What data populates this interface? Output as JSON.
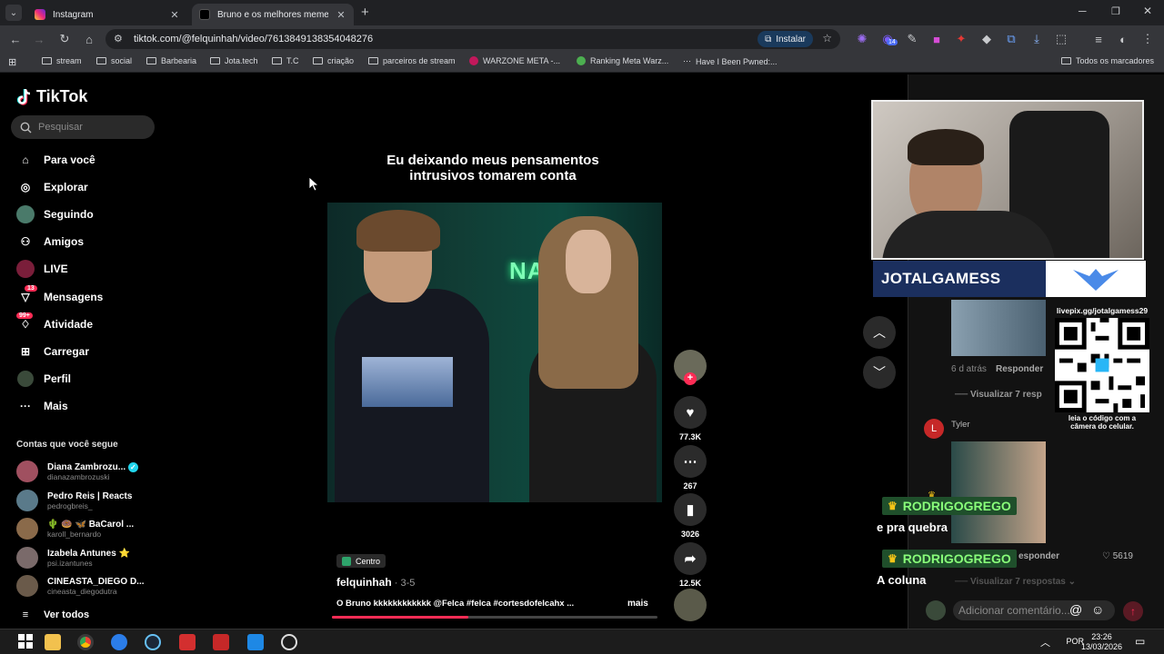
{
  "browser": {
    "tabs": [
      {
        "title": "Instagram",
        "active": false
      },
      {
        "title": "Bruno e os melhores memes de",
        "active": true
      }
    ],
    "url": "tiktok.com/@felquinhah/video/7613849138354048276",
    "install_label": "Instalar",
    "bookmarks": [
      "stream",
      "social",
      "Barbearia",
      "Jota.tech",
      "T.C",
      "criação",
      "parceiros de stream",
      "WARZONE META -...",
      "Ranking Meta Warz...",
      "Have I Been Pwned:..."
    ],
    "all_bookmarks": "Todos os marcadores",
    "ext_badge": "14"
  },
  "tiktok": {
    "logo": "TikTok",
    "search_placeholder": "Pesquisar",
    "nav": [
      {
        "label": "Para você",
        "icon": "home-icon"
      },
      {
        "label": "Explorar",
        "icon": "compass-icon"
      },
      {
        "label": "Seguindo",
        "icon": "following-avatar-icon"
      },
      {
        "label": "Amigos",
        "icon": "friends-icon"
      },
      {
        "label": "LIVE",
        "icon": "live-icon"
      },
      {
        "label": "Mensagens",
        "icon": "messages-icon",
        "badge": "13"
      },
      {
        "label": "Atividade",
        "icon": "activity-icon",
        "badge": "99+"
      },
      {
        "label": "Carregar",
        "icon": "upload-icon"
      },
      {
        "label": "Perfil",
        "icon": "profile-avatar-icon"
      },
      {
        "label": "Mais",
        "icon": "more-icon"
      }
    ],
    "following_title": "Contas que você segue",
    "accounts": [
      {
        "name": "Diana Zambrozu...",
        "handle": "dianazambrozuski",
        "verified": true,
        "color": "#a05060"
      },
      {
        "name": "Pedro Reis | Reacts",
        "handle": "pedrogbreis_",
        "verified": false,
        "color": "#5a7a8a"
      },
      {
        "name": "🌵 🍩 🦋 BaCarol ...",
        "handle": "karoll_bernardo",
        "verified": false,
        "color": "#8a6a4a"
      },
      {
        "name": "Izabela Antunes ⭐",
        "handle": "psi.izantunes",
        "verified": false,
        "color": "#7a6a6a"
      },
      {
        "name": "CINEASTA_DIEGO D...",
        "handle": "cineasta_diegodutra",
        "verified": false,
        "color": "#6a5a4a"
      }
    ],
    "see_all": "Ver todos",
    "video": {
      "caption_line1": "Eu deixando meus pensamentos",
      "caption_line2": "intrusivos tomarem conta",
      "scene_text": "NANÁ",
      "tag": "Centro",
      "author": "felquinhah",
      "date": " · 3-5",
      "description": "O Bruno kkkkkkkkkkkk @Felca #felca #cortesdofelcahx ...",
      "more": "mais",
      "progress": 0.42
    },
    "actions": {
      "likes": "77.3K",
      "comments": "267",
      "saves": "3026",
      "shares": "12.5K"
    },
    "comments": {
      "time1": "6 d atrás",
      "reply1": "Responder",
      "view_replies1": "Visualizar 7 resp",
      "user2": "Tyler",
      "user2_initial": "L",
      "reply2": "esponder",
      "likes2": "5619",
      "view_replies2": "Visualizar 7 respostas",
      "add_placeholder": "Adicionar comentário..."
    }
  },
  "stream": {
    "channel": "JOTALGAMESS",
    "qr_url": "livepix.gg/jotalgamess29",
    "qr_caption_1": "leia o código com a",
    "qr_caption_2": "câmera do celular.",
    "chat": [
      {
        "user": "RODRIGOGREGO",
        "message": "e pra quebra"
      },
      {
        "user": "RODRIGOGREGO",
        "message": "A coluna"
      }
    ]
  },
  "taskbar": {
    "lang": "POR",
    "time": "23:26",
    "date": "13/03/2026"
  }
}
